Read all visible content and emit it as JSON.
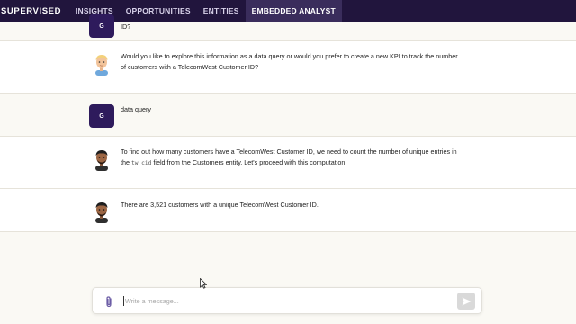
{
  "nav": {
    "brand": "SUPERVISED",
    "items": [
      {
        "label": "INSIGHTS"
      },
      {
        "label": "OPPORTUNITIES"
      },
      {
        "label": "ENTITIES"
      },
      {
        "label": "EMBEDDED ANALYST"
      }
    ],
    "active": "EMBEDDED ANALYST"
  },
  "conversation": {
    "messages": [
      {
        "role": "user",
        "initial": "G",
        "text": "ID?"
      },
      {
        "role": "assistant",
        "text": "Would you like to explore this information as a data query or would you prefer to create a new KPI to track the number of customers with a TelecomWest Customer ID?"
      },
      {
        "role": "user",
        "initial": "G",
        "text": "data query"
      },
      {
        "role": "assistant",
        "text_before": "To find out how many customers have a TelecomWest Customer ID, we need to count the number of unique entries in the ",
        "code": "tw_cid",
        "text_after": " field from the Customers entity. Let's proceed with this computation."
      },
      {
        "role": "assistant",
        "text": "There are 3,521 customers with a unique TelecomWest Customer ID."
      }
    ]
  },
  "composer": {
    "placeholder": "Write a message...",
    "value": ""
  },
  "icons": {
    "attach": "paperclip-icon",
    "send": "send-icon"
  },
  "colors": {
    "nav_bg": "#21153d",
    "nav_active_bg": "#3a2d5c",
    "user_avatar_bg": "#2e1b5c",
    "attach_icon": "#6b5ca5"
  }
}
